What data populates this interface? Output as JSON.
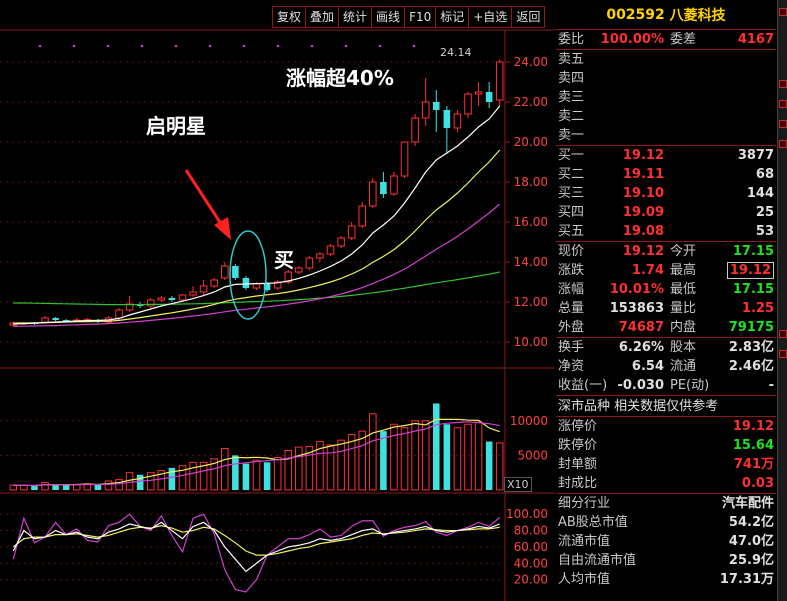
{
  "toolbar": [
    "复权",
    "叠加",
    "统计",
    "画线",
    "F10",
    "标记",
    "+自选",
    "返回"
  ],
  "annotations": {
    "morning_star": "启明星",
    "buy": "买",
    "rise": "涨幅超40%"
  },
  "header": {
    "code": "002592",
    "name": "八菱科技"
  },
  "top": {
    "weibi_l": "委比",
    "weibi": "100.00%",
    "weicha_l": "委差",
    "weicha": "4167"
  },
  "sells": [
    "卖五",
    "卖四",
    "卖三",
    "卖二",
    "卖一"
  ],
  "buys": [
    {
      "l": "买一",
      "p": "19.12",
      "v": "3877"
    },
    {
      "l": "买二",
      "p": "19.11",
      "v": "68"
    },
    {
      "l": "买三",
      "p": "19.10",
      "v": "144"
    },
    {
      "l": "买四",
      "p": "19.09",
      "v": "25"
    },
    {
      "l": "买五",
      "p": "19.08",
      "v": "53"
    }
  ],
  "quote": [
    {
      "l": "现价",
      "v": "19.12",
      "c1": "red",
      "l2": "今开",
      "v2": "17.15",
      "c2": "green"
    },
    {
      "l": "涨跌",
      "v": "1.74",
      "c1": "red",
      "l2": "最高",
      "v2": "19.12",
      "c2": "red"
    },
    {
      "l": "涨幅",
      "v": "10.01%",
      "c1": "red",
      "l2": "最低",
      "v2": "17.15",
      "c2": "green"
    },
    {
      "l": "总量",
      "v": "153863",
      "c1": "white",
      "l2": "量比",
      "v2": "1.25",
      "c2": "red"
    },
    {
      "l": "外盘",
      "v": "74687",
      "c1": "red",
      "l2": "内盘",
      "v2": "79175",
      "c2": "green"
    }
  ],
  "fund": [
    {
      "l": "换手",
      "v": "6.26%",
      "l2": "股本",
      "v2": "2.83亿"
    },
    {
      "l": "净资",
      "v": "6.54",
      "l2": "流通",
      "v2": "2.46亿"
    },
    {
      "l": "收益(一)",
      "v": "-0.030",
      "l2": "PE(动)",
      "v2": "-"
    }
  ],
  "section": "深市品种  相关数据仅供参考",
  "limits": [
    {
      "l": "涨停价",
      "v": "19.12",
      "c": "red"
    },
    {
      "l": "跌停价",
      "v": "15.64",
      "c": "green"
    },
    {
      "l": "封单额",
      "v": "741万",
      "c": "red"
    },
    {
      "l": "封成比",
      "v": "0.03",
      "c": "red"
    }
  ],
  "industry": [
    {
      "l": "细分行业",
      "v": "汽车配件"
    },
    {
      "l": "AB股总市值",
      "v": "54.2亿"
    },
    {
      "l": "流通市值",
      "v": "47.0亿"
    },
    {
      "l": "自由流通市值",
      "v": "25.9亿"
    },
    {
      "l": "人均市值",
      "v": "17.31万"
    }
  ],
  "price_axis": [
    "24.00",
    "22.00",
    "20.00",
    "18.00",
    "16.00",
    "14.00",
    "12.00",
    "10.00"
  ],
  "vol_axis": [
    "10000",
    "5000"
  ],
  "vol_unit": "X10",
  "kdj_axis": [
    "100.00",
    "80.00",
    "60.00",
    "40.00",
    "20.00"
  ],
  "high_label": "24.14",
  "chart_data": {
    "type": "candlestick",
    "price_range": [
      9.2,
      25.2
    ],
    "candles": [
      [
        10.85,
        10.95,
        10.8,
        11.02
      ],
      [
        10.9,
        10.95,
        10.85,
        11.0
      ],
      [
        10.95,
        10.9,
        10.85,
        11.0
      ],
      [
        11.0,
        11.2,
        10.98,
        11.3
      ],
      [
        11.2,
        11.1,
        11.05,
        11.25
      ],
      [
        11.1,
        11.05,
        11.0,
        11.15
      ],
      [
        11.05,
        11.1,
        11.0,
        11.2
      ],
      [
        11.1,
        11.12,
        11.05,
        11.2
      ],
      [
        11.1,
        11.0,
        10.95,
        11.15
      ],
      [
        11.0,
        11.2,
        10.95,
        11.3
      ],
      [
        11.2,
        11.6,
        11.1,
        11.7
      ],
      [
        11.6,
        11.9,
        11.5,
        12.3
      ],
      [
        11.9,
        11.8,
        11.7,
        12.0
      ],
      [
        11.8,
        12.1,
        11.7,
        12.2
      ],
      [
        12.1,
        12.2,
        12.0,
        12.3
      ],
      [
        12.2,
        12.1,
        12.0,
        12.3
      ],
      [
        12.1,
        12.35,
        12.0,
        12.4
      ],
      [
        12.35,
        12.5,
        12.25,
        12.8
      ],
      [
        12.5,
        12.8,
        12.3,
        13.1
      ],
      [
        12.8,
        13.1,
        12.7,
        13.2
      ],
      [
        13.2,
        13.8,
        13.1,
        14.0
      ],
      [
        13.8,
        13.2,
        13.1,
        13.9
      ],
      [
        13.2,
        12.7,
        12.6,
        13.3
      ],
      [
        12.7,
        12.9,
        12.6,
        13.0
      ],
      [
        12.9,
        12.6,
        12.5,
        13.0
      ],
      [
        12.7,
        13.0,
        12.6,
        13.1
      ],
      [
        13.0,
        13.5,
        12.9,
        13.6
      ],
      [
        13.5,
        13.7,
        13.4,
        13.8
      ],
      [
        13.7,
        14.2,
        13.6,
        14.3
      ],
      [
        14.2,
        14.4,
        14.0,
        14.5
      ],
      [
        14.4,
        14.8,
        14.3,
        14.9
      ],
      [
        14.8,
        15.2,
        14.7,
        15.3
      ],
      [
        15.2,
        15.8,
        15.1,
        16.0
      ],
      [
        15.8,
        16.8,
        15.7,
        17.0
      ],
      [
        16.8,
        18.0,
        16.7,
        18.2
      ],
      [
        18.0,
        17.4,
        17.2,
        18.5
      ],
      [
        17.4,
        18.3,
        17.3,
        18.5
      ],
      [
        18.3,
        20.0,
        18.2,
        20.0
      ],
      [
        20.0,
        21.2,
        19.8,
        21.4
      ],
      [
        21.2,
        22.0,
        20.8,
        23.2
      ],
      [
        22.0,
        21.6,
        20.5,
        22.6
      ],
      [
        21.6,
        20.7,
        19.4,
        21.8
      ],
      [
        20.7,
        21.4,
        20.5,
        21.6
      ],
      [
        21.4,
        22.4,
        21.2,
        22.5
      ],
      [
        22.4,
        22.5,
        21.8,
        23.0
      ],
      [
        22.5,
        22.0,
        21.7,
        23.0
      ],
      [
        22.1,
        24.0,
        21.8,
        24.14
      ]
    ],
    "ma_yellow": [
      10.9,
      10.92,
      10.94,
      10.97,
      11.0,
      11.02,
      11.05,
      11.07,
      11.08,
      11.1,
      11.18,
      11.35,
      11.5,
      11.65,
      11.8,
      11.92,
      12.04,
      12.17,
      12.32,
      12.5,
      12.75,
      12.88,
      12.9,
      12.92,
      12.93,
      12.96,
      13.05,
      13.18,
      13.35,
      13.55,
      13.78,
      14.05,
      14.4,
      14.85,
      15.45,
      15.85,
      16.3,
      16.95,
      17.7,
      18.5,
      19.1,
      19.45,
      19.8,
      20.25,
      20.75,
      21.15,
      21.8
    ],
    "ma_white": [
      10.95,
      10.95,
      10.96,
      10.97,
      10.98,
      11.0,
      11.01,
      11.02,
      11.03,
      11.04,
      11.08,
      11.15,
      11.22,
      11.3,
      11.38,
      11.46,
      11.55,
      11.65,
      11.75,
      11.88,
      12.02,
      12.14,
      12.22,
      12.3,
      12.36,
      12.42,
      12.5,
      12.6,
      12.72,
      12.85,
      13.0,
      13.18,
      13.4,
      13.65,
      13.98,
      14.28,
      14.62,
      15.05,
      15.55,
      16.1,
      16.6,
      17.0,
      17.45,
      17.95,
      18.5,
      19.0,
      19.6
    ],
    "ma_magenta": [
      10.78,
      10.79,
      10.8,
      10.81,
      10.82,
      10.84,
      10.86,
      10.88,
      10.9,
      10.92,
      10.95,
      10.99,
      11.03,
      11.08,
      11.13,
      11.18,
      11.24,
      11.3,
      11.36,
      11.43,
      11.51,
      11.58,
      11.64,
      11.7,
      11.76,
      11.82,
      11.89,
      11.97,
      12.06,
      12.16,
      12.27,
      12.4,
      12.55,
      12.72,
      12.93,
      13.14,
      13.38,
      13.65,
      13.96,
      14.3,
      14.64,
      14.95,
      15.28,
      15.65,
      16.05,
      16.45,
      16.9
    ],
    "ma_green": [
      11.95,
      11.95,
      11.94,
      11.93,
      11.92,
      11.91,
      11.9,
      11.89,
      11.88,
      11.87,
      11.87,
      11.87,
      11.87,
      11.88,
      11.88,
      11.89,
      11.9,
      11.91,
      11.92,
      11.94,
      11.96,
      11.98,
      12.0,
      12.02,
      12.04,
      12.06,
      12.09,
      12.12,
      12.15,
      12.19,
      12.23,
      12.28,
      12.33,
      12.39,
      12.46,
      12.53,
      12.61,
      12.69,
      12.78,
      12.87,
      12.96,
      13.04,
      13.12,
      13.21,
      13.3,
      13.39,
      13.5
    ],
    "volume": [
      700,
      650,
      600,
      1100,
      700,
      750,
      800,
      900,
      850,
      1300,
      1500,
      2500,
      2200,
      2500,
      2800,
      3200,
      3500,
      4000,
      4000,
      4500,
      6000,
      5000,
      3800,
      4300,
      4000,
      4700,
      5700,
      6200,
      6300,
      7000,
      6500,
      7200,
      8000,
      8500,
      11000,
      8500,
      9500,
      9000,
      10000,
      10000,
      12500,
      9500,
      9000,
      9500,
      9800,
      7000,
      6800
    ],
    "vol_range": [
      0,
      13000
    ],
    "kdj_k": [
      55,
      80,
      70,
      72,
      80,
      75,
      78,
      72,
      70,
      78,
      82,
      88,
      85,
      82,
      90,
      80,
      70,
      85,
      90,
      80,
      60,
      45,
      30,
      40,
      50,
      55,
      60,
      62,
      65,
      70,
      68,
      70,
      75,
      80,
      82,
      75,
      78,
      80,
      82,
      85,
      80,
      78,
      80,
      82,
      85,
      83,
      88
    ],
    "kdj_d": [
      60,
      70,
      72,
      72,
      75,
      75,
      76,
      74,
      72,
      74,
      78,
      82,
      84,
      83,
      86,
      83,
      78,
      80,
      84,
      82,
      74,
      65,
      55,
      50,
      50,
      52,
      55,
      58,
      60,
      64,
      66,
      68,
      70,
      74,
      77,
      76,
      77,
      78,
      80,
      82,
      81,
      80,
      80,
      81,
      82,
      82,
      84
    ],
    "kdj_j": [
      45,
      95,
      65,
      72,
      90,
      75,
      82,
      68,
      66,
      86,
      90,
      100,
      85,
      80,
      98,
      74,
      54,
      95,
      100,
      76,
      32,
      8,
      5,
      20,
      50,
      60,
      70,
      70,
      75,
      82,
      72,
      74,
      85,
      92,
      92,
      73,
      80,
      84,
      86,
      91,
      78,
      74,
      80,
      84,
      90,
      85,
      96
    ],
    "kdj_range": [
      0,
      110
    ]
  }
}
